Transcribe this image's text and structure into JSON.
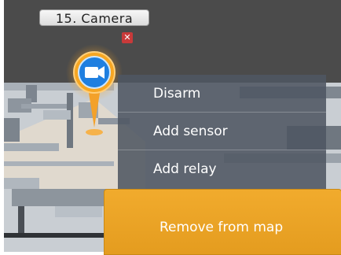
{
  "camera_label": "15. Camera",
  "remove_badge": "✕",
  "menu": {
    "items": [
      "Disarm",
      "Add sensor",
      "Add relay"
    ],
    "remove_label": "Remove from map"
  },
  "colors": {
    "accent": "#e89f1f",
    "camera_blue": "#2d8cf0",
    "menu_bg": "#4e5662"
  },
  "icons": {
    "marker": "camera-marker-icon",
    "camera": "video-camera-icon",
    "close": "close-icon"
  }
}
